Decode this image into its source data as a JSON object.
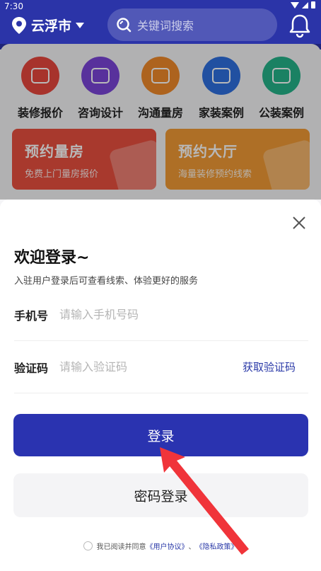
{
  "status": {
    "time": "7:30"
  },
  "header": {
    "city": "云浮市",
    "search_placeholder": "关键词搜索"
  },
  "categories": [
    {
      "label": "装修报价",
      "color": "#e8473d"
    },
    {
      "label": "咨询设计",
      "color": "#7a45d8"
    },
    {
      "label": "沟通量房",
      "color": "#f08a2a"
    },
    {
      "label": "家装案例",
      "color": "#2f6fe0"
    },
    {
      "label": "公装案例",
      "color": "#25b38a"
    }
  ],
  "banners": [
    {
      "title": "预约量房",
      "subtitle": "免费上门量房报价",
      "color": "#e9503f"
    },
    {
      "title": "预约大厅",
      "subtitle": "海量装修预约线索",
      "color": "#f29a35"
    }
  ],
  "login": {
    "title": "欢迎登录~",
    "subtitle": "入驻用户登录后可查看线索、体验更好的服务",
    "phone_label": "手机号",
    "phone_placeholder": "请输入手机号码",
    "code_label": "验证码",
    "code_placeholder": "请输入验证码",
    "get_code": "获取验证码",
    "login_button": "登录",
    "password_login_button": "密码登录",
    "agreement_prefix": "我已阅读并同意",
    "user_agreement": "《用户协议》",
    "separator": "、",
    "privacy_policy": "《隐私政策》"
  },
  "colors": {
    "primary": "#2a33b0",
    "arrow": "#f0343a"
  }
}
